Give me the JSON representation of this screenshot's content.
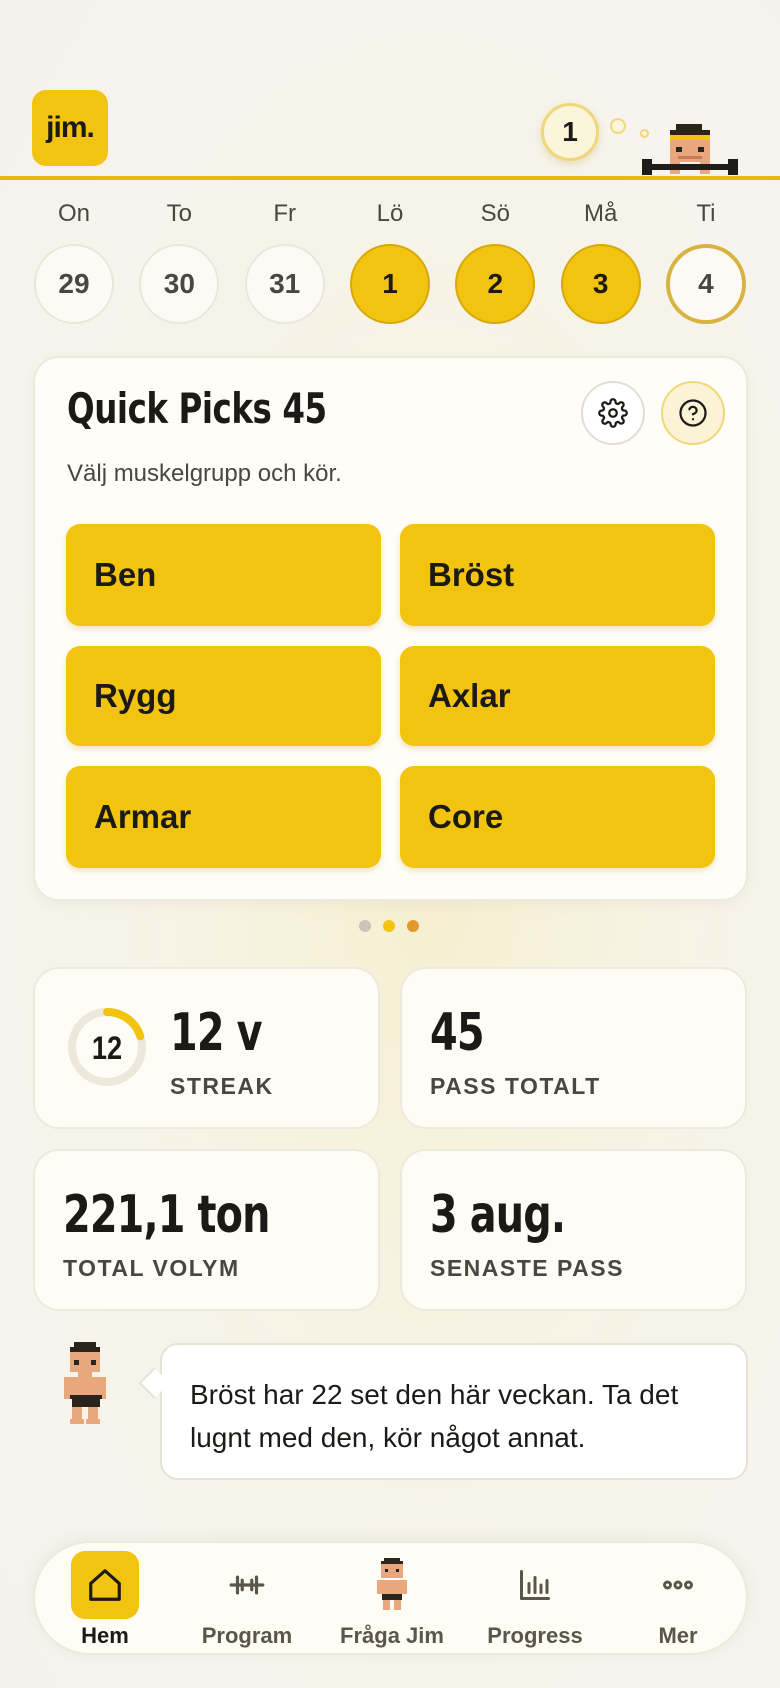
{
  "header": {
    "logo_text": "jim.",
    "bubble_count": "1"
  },
  "week": [
    {
      "label": "On",
      "date": "29",
      "state": "empty"
    },
    {
      "label": "To",
      "date": "30",
      "state": "empty"
    },
    {
      "label": "Fr",
      "date": "31",
      "state": "empty"
    },
    {
      "label": "Lö",
      "date": "1",
      "state": "done"
    },
    {
      "label": "Sö",
      "date": "2",
      "state": "done"
    },
    {
      "label": "Må",
      "date": "3",
      "state": "done"
    },
    {
      "label": "Ti",
      "date": "4",
      "state": "today"
    }
  ],
  "quick_picks": {
    "title": "Quick Picks 45",
    "subtitle": "Välj muskelgrupp och kör.",
    "buttons": [
      "Ben",
      "Bröst",
      "Rygg",
      "Axlar",
      "Armar",
      "Core"
    ],
    "settings_icon": "gear-icon",
    "help_icon": "question-circle-icon"
  },
  "pager": {
    "count": 3,
    "active_index": 1,
    "colors": [
      "#c9c4b6",
      "#f2c40f",
      "#e29a2c"
    ]
  },
  "stats": {
    "streak": {
      "ring_text": "12",
      "value": "12 v",
      "label": "STREAK",
      "progress": 0.2
    },
    "sessions": {
      "value": "45",
      "label": "PASS TOTALT"
    },
    "volume": {
      "value": "221,1 ton",
      "label": "TOTAL VOLYM"
    },
    "last": {
      "value": "3 aug.",
      "label": "SENASTE PASS"
    }
  },
  "coach": {
    "message": "Bröst har 22 set den här veckan. Ta det lugnt med den, kör något annat."
  },
  "nav": {
    "items": [
      {
        "label": "Hem",
        "icon": "home-icon",
        "active": true
      },
      {
        "label": "Program",
        "icon": "dumbbell-icon",
        "active": false
      },
      {
        "label": "Fråga Jim",
        "icon": "jim-avatar-icon",
        "active": false
      },
      {
        "label": "Progress",
        "icon": "bar-chart-icon",
        "active": false
      },
      {
        "label": "Mer",
        "icon": "more-icon",
        "active": false
      }
    ]
  },
  "colors": {
    "accent": "#f2c40f",
    "accent_dark": "#e8b90c",
    "text": "#1c1a16"
  }
}
